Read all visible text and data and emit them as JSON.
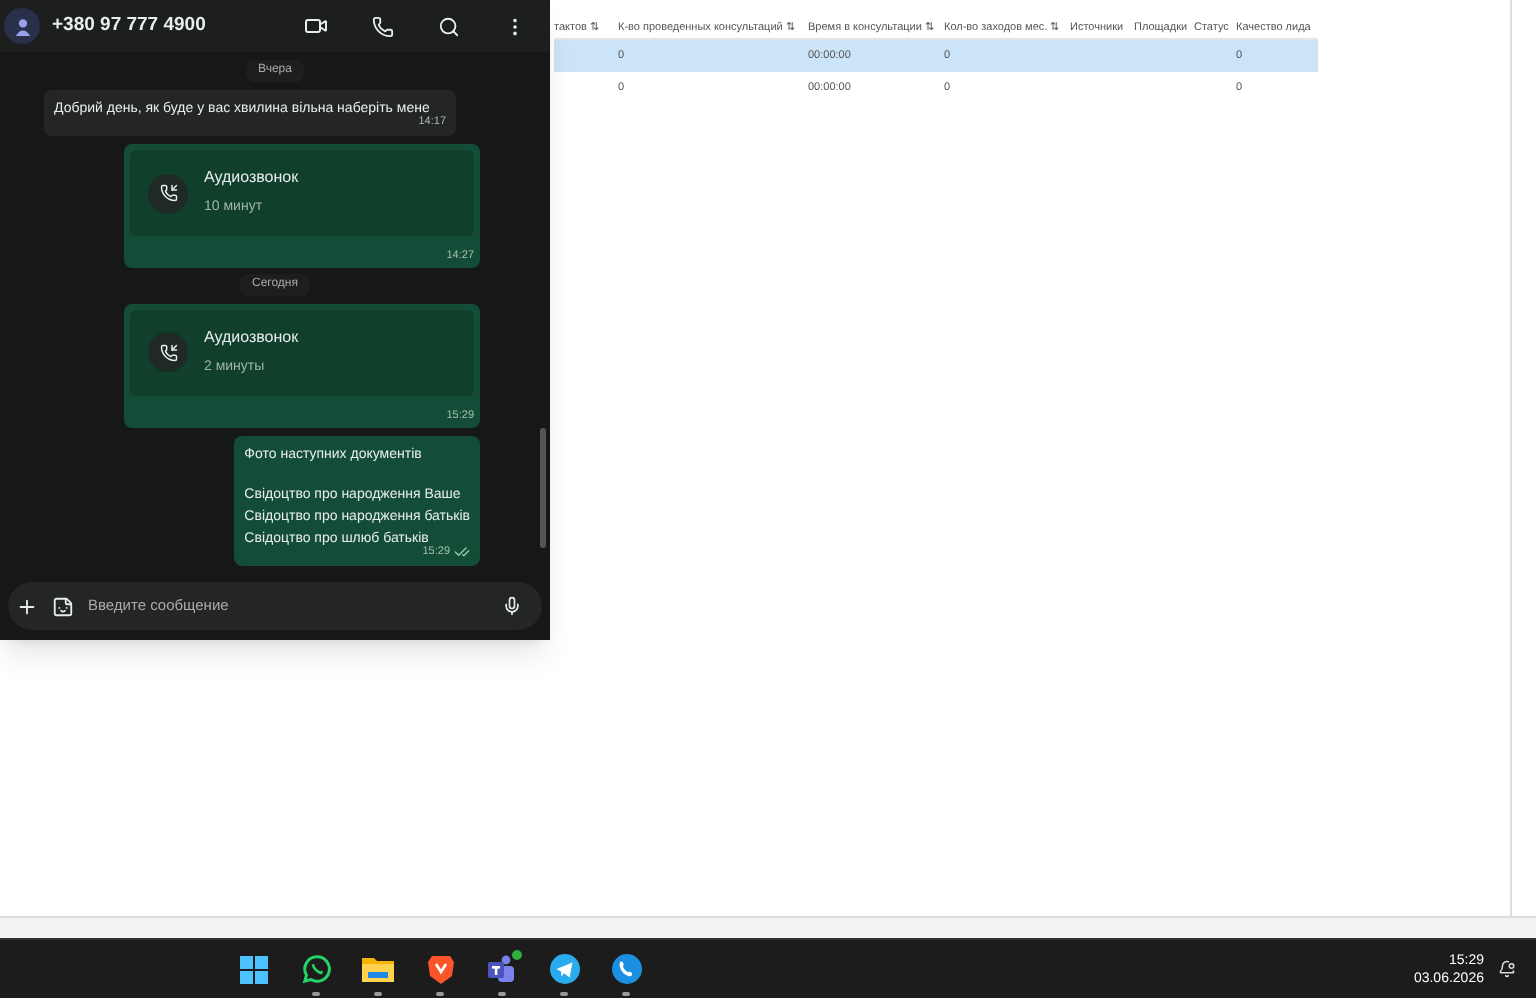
{
  "table": {
    "columns": [
      "тактов ⇅",
      "К-во проведенных консультаций ⇅",
      "Время в консультации ⇅",
      "Кол-во заходов мес. ⇅",
      "Источники",
      "Площадки",
      "Статус",
      "Качество лида"
    ],
    "rows": [
      {
        "selected": true,
        "cells": [
          null,
          "0",
          "00:00:00",
          "0",
          null,
          null,
          null,
          "0"
        ]
      },
      {
        "selected": false,
        "cells": [
          null,
          "0",
          "00:00:00",
          "0",
          null,
          null,
          null,
          "0"
        ]
      }
    ]
  },
  "chat": {
    "contact": "+380 97 777 4900",
    "messages": [
      {
        "kind": "date",
        "text": "Вчера"
      },
      {
        "kind": "text",
        "outgoing": false,
        "paragraphs": [
          [
            "Добрий день, як буде у вас хвилина вільна наберіть мене"
          ]
        ],
        "time": "14:17"
      },
      {
        "kind": "call",
        "outgoing": true,
        "title": "Аудиозвонок",
        "duration": "10 минут",
        "time": "14:27"
      },
      {
        "kind": "date",
        "text": "Сегодня"
      },
      {
        "kind": "call",
        "outgoing": true,
        "title": "Аудиозвонок",
        "duration": "2 минуты",
        "time": "15:29"
      },
      {
        "kind": "text",
        "outgoing": true,
        "paragraphs": [
          [
            "Фото наступних документів"
          ],
          [
            "Свідоцтво про народження Ваше",
            "Свідоцтво про народження батьків",
            "Свідоцтво про шлюб батьків"
          ]
        ],
        "time": "15:29",
        "read": true
      }
    ],
    "input": {
      "placeholder": "Введите сообщение"
    }
  },
  "taskbar": {
    "apps": [
      {
        "kind": "start"
      },
      {
        "kind": "whatsapp",
        "running": true
      },
      {
        "kind": "folder",
        "running": true
      },
      {
        "kind": "brave",
        "running": true
      },
      {
        "kind": "teams",
        "running": true,
        "badge": true
      },
      {
        "kind": "telegram",
        "running": true
      },
      {
        "kind": "phone",
        "running": true
      }
    ],
    "time": "15:29",
    "date": "03.06.2026"
  }
}
